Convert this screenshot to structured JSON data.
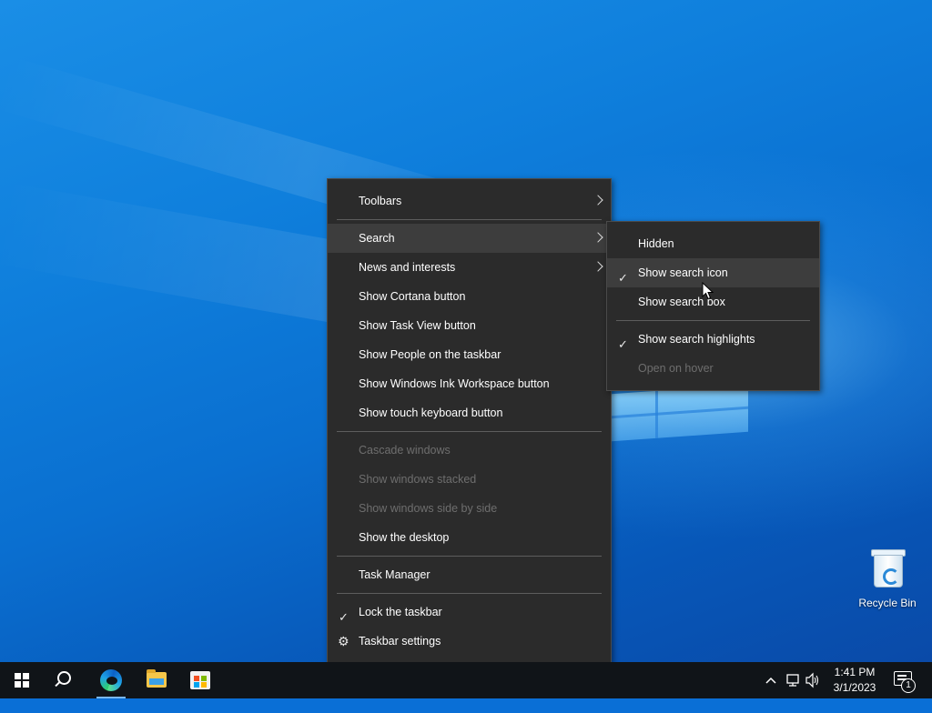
{
  "desktop": {
    "recycle_bin_label": "Recycle Bin"
  },
  "context_menu": {
    "items": [
      {
        "label": "Toolbars",
        "submenu": true
      },
      {
        "label": "Search",
        "submenu": true,
        "active": true
      },
      {
        "label": "News and interests",
        "submenu": true
      },
      {
        "label": "Show Cortana button"
      },
      {
        "label": "Show Task View button"
      },
      {
        "label": "Show People on the taskbar"
      },
      {
        "label": "Show Windows Ink Workspace button"
      },
      {
        "label": "Show touch keyboard button"
      },
      {
        "label": "Cascade windows",
        "disabled": true
      },
      {
        "label": "Show windows stacked",
        "disabled": true
      },
      {
        "label": "Show windows side by side",
        "disabled": true
      },
      {
        "label": "Show the desktop"
      },
      {
        "label": "Task Manager"
      },
      {
        "label": "Lock the taskbar",
        "checked": true
      },
      {
        "label": "Taskbar settings",
        "icon": "gear-icon"
      }
    ]
  },
  "search_submenu": {
    "items": [
      {
        "label": "Hidden"
      },
      {
        "label": "Show search icon",
        "checked": true,
        "active": true
      },
      {
        "label": "Show search box"
      },
      {
        "label": "Show search highlights",
        "checked": true
      },
      {
        "label": "Open on hover",
        "disabled": true
      }
    ]
  },
  "taskbar": {
    "pinned": [
      "windows-start-icon",
      "search-icon",
      "edge-icon",
      "file-explorer-icon",
      "microsoft-store-icon"
    ],
    "tray_icons": [
      "chevron-up-icon",
      "network-icon",
      "volume-icon"
    ],
    "clock": {
      "time": "1:41 PM",
      "date": "3/1/2023"
    },
    "notification_count": "1"
  },
  "colors": {
    "menu_bg": "#2b2b2b",
    "menu_hover": "#3d3d3d",
    "disabled_text": "#6e6e6e",
    "taskbar_bg": "#101418",
    "accent": "#7ab7ec"
  }
}
